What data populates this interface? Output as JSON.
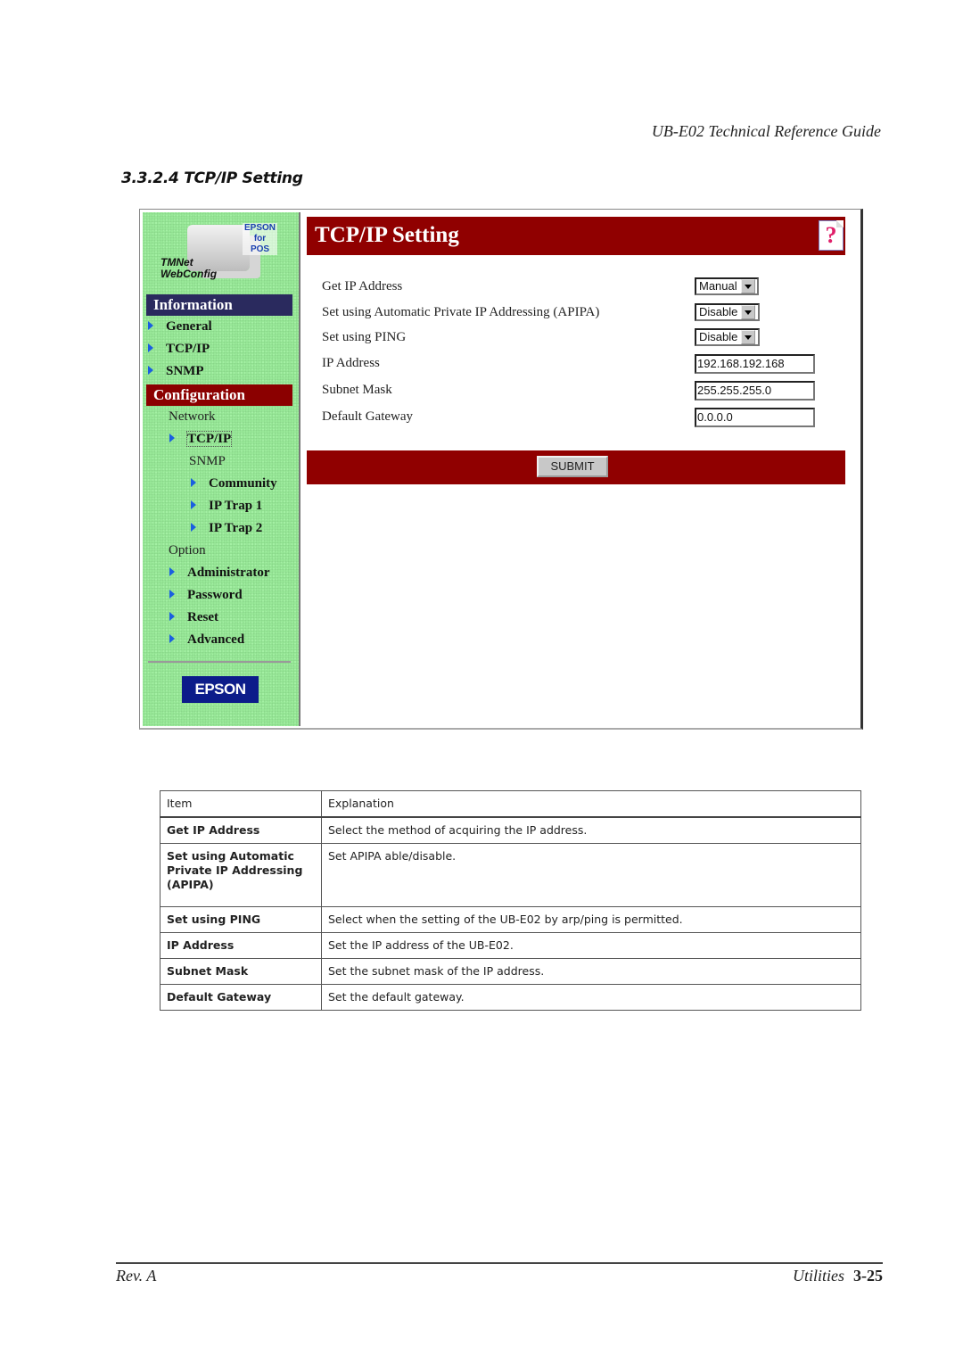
{
  "running_head": "UB-E02 Technical Reference Guide",
  "section_title": "3.3.2.4 TCP/IP Setting",
  "webconfig": {
    "logo": {
      "brand_lines": [
        "EPSON",
        "for",
        "POS"
      ],
      "product_lines": [
        "TMNet",
        "WebConfig"
      ]
    },
    "sidebar": {
      "information_header": "Information",
      "information_items": [
        {
          "label": "General"
        },
        {
          "label": "TCP/IP"
        },
        {
          "label": "SNMP"
        }
      ],
      "configuration_header": "Configuration",
      "network_label": "Network",
      "network_items": [
        {
          "label": "TCP/IP",
          "active": true
        }
      ],
      "snmp_label": "SNMP",
      "snmp_items": [
        {
          "label": "Community"
        },
        {
          "label": "IP Trap 1"
        },
        {
          "label": "IP Trap 2"
        }
      ],
      "option_label": "Option",
      "option_items": [
        {
          "label": "Administrator"
        },
        {
          "label": "Password"
        },
        {
          "label": "Reset"
        },
        {
          "label": "Advanced"
        }
      ],
      "footer_logo": "EPSON"
    },
    "main": {
      "title": "TCP/IP Setting",
      "help_icon_glyph": "?",
      "fields": [
        {
          "label": "Get IP Address",
          "type": "select",
          "value": "Manual"
        },
        {
          "label": "Set using Automatic Private IP Addressing (APIPA)",
          "type": "select",
          "value": "Disable"
        },
        {
          "label": "Set using PING",
          "type": "select",
          "value": "Disable"
        },
        {
          "label": "IP Address",
          "type": "text",
          "value": "192.168.192.168"
        },
        {
          "label": "Subnet Mask",
          "type": "text",
          "value": "255.255.255.0"
        },
        {
          "label": "Default Gateway",
          "type": "text",
          "value": "0.0.0.0"
        }
      ],
      "submit_label": "SUBMIT"
    },
    "colors": {
      "sidebar_bg": "#98e898",
      "info_header": "#2a2a5e",
      "config_header": "#8b0000",
      "title_bar": "#900000",
      "arrow": "#1a5fe0"
    }
  },
  "table": {
    "headers": [
      "Item",
      "Explanation"
    ],
    "rows": [
      {
        "item": "Get IP Address",
        "explanation": "Select the method of acquiring the IP address."
      },
      {
        "item": "Set using Automatic Private IP Addressing (APIPA)",
        "explanation": "Set APIPA able/disable."
      },
      {
        "item": "Set using PING",
        "explanation": "Select when the setting of the UB-E02 by arp/ping is permitted."
      },
      {
        "item": "IP Address",
        "explanation": "Set the IP address of the UB-E02."
      },
      {
        "item": "Subnet Mask",
        "explanation": "Set the subnet mask of the IP address."
      },
      {
        "item": "Default Gateway",
        "explanation": "Set the default gateway."
      }
    ]
  },
  "footer": {
    "revision": "Rev. A",
    "section": "Utilities",
    "page": "3-25"
  }
}
